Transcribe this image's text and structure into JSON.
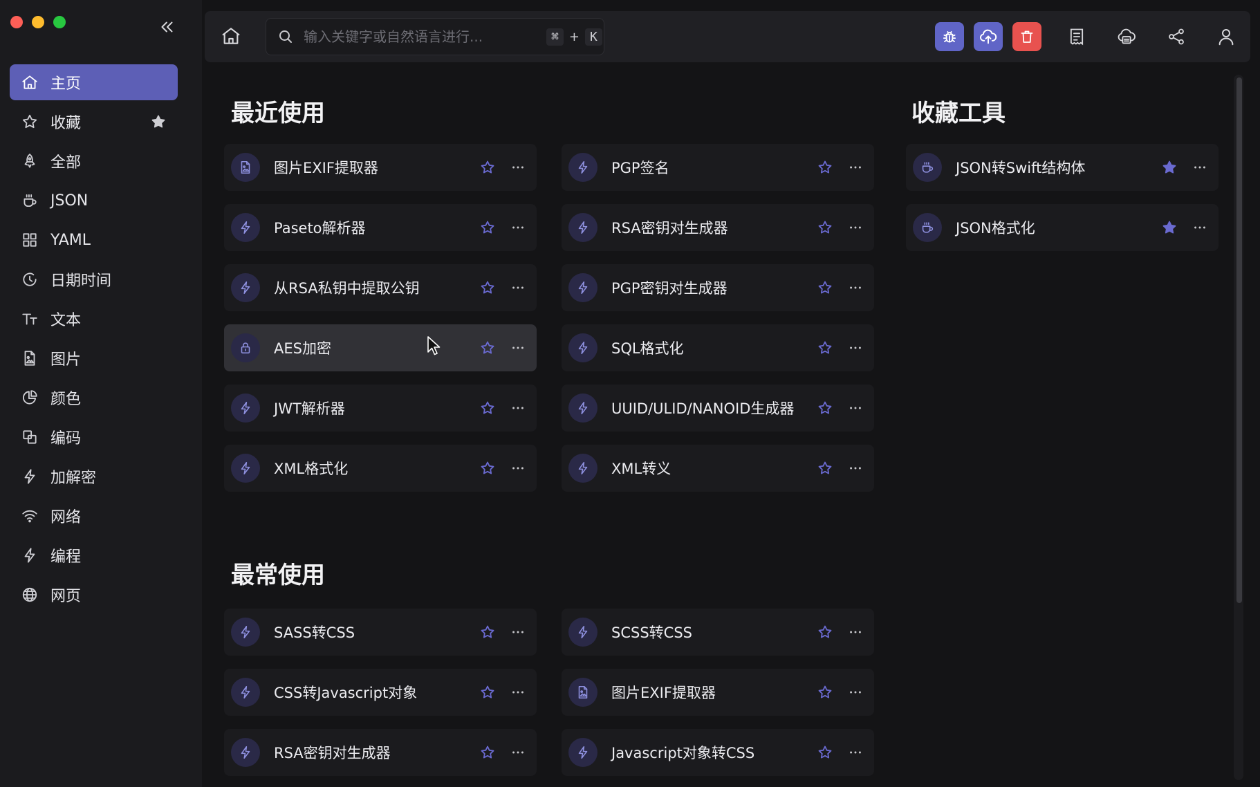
{
  "sidebar": {
    "items": [
      {
        "label": "主页",
        "icon": "home-icon"
      },
      {
        "label": "收藏",
        "icon": "star-icon"
      },
      {
        "label": "全部",
        "icon": "rocket-icon"
      },
      {
        "label": "JSON",
        "icon": "coffee-icon"
      },
      {
        "label": "YAML",
        "icon": "grid-icon"
      },
      {
        "label": "日期时间",
        "icon": "clock-icon"
      },
      {
        "label": "文本",
        "icon": "text-icon"
      },
      {
        "label": "图片",
        "icon": "file-image-icon"
      },
      {
        "label": "颜色",
        "icon": "pie-icon"
      },
      {
        "label": "编码",
        "icon": "copy-icon"
      },
      {
        "label": "加解密",
        "icon": "bolt-icon"
      },
      {
        "label": "网络",
        "icon": "wifi-icon"
      },
      {
        "label": "编程",
        "icon": "bolt-icon"
      },
      {
        "label": "网页",
        "icon": "globe-icon"
      }
    ]
  },
  "search": {
    "placeholder": "输入关键字或自然语言进行...",
    "shortcut_mod": "⌘",
    "shortcut_plus": "+",
    "shortcut_key": "K"
  },
  "recent": {
    "title": "最近使用",
    "items": [
      {
        "label": "图片EXIF提取器",
        "icon": "file-image-icon"
      },
      {
        "label": "PGP签名",
        "icon": "bolt-icon"
      },
      {
        "label": "Paseto解析器",
        "icon": "bolt-icon"
      },
      {
        "label": "RSA密钥对生成器",
        "icon": "bolt-icon"
      },
      {
        "label": "从RSA私钥中提取公钥",
        "icon": "bolt-icon"
      },
      {
        "label": "PGP密钥对生成器",
        "icon": "bolt-icon"
      },
      {
        "label": "AES加密",
        "icon": "lock-icon"
      },
      {
        "label": "SQL格式化",
        "icon": "bolt-icon"
      },
      {
        "label": "JWT解析器",
        "icon": "bolt-icon"
      },
      {
        "label": "UUID/ULID/NANOID生成器",
        "icon": "bolt-icon"
      },
      {
        "label": "XML格式化",
        "icon": "bolt-icon"
      },
      {
        "label": "XML转义",
        "icon": "bolt-icon"
      }
    ]
  },
  "frequent": {
    "title": "最常使用",
    "items": [
      {
        "label": "SASS转CSS",
        "icon": "bolt-icon"
      },
      {
        "label": "SCSS转CSS",
        "icon": "bolt-icon"
      },
      {
        "label": "CSS转Javascript对象",
        "icon": "bolt-icon"
      },
      {
        "label": "图片EXIF提取器",
        "icon": "file-image-icon"
      },
      {
        "label": "RSA密钥对生成器",
        "icon": "bolt-icon"
      },
      {
        "label": "Javascript对象转CSS",
        "icon": "bolt-icon"
      }
    ]
  },
  "favorites": {
    "title": "收藏工具",
    "items": [
      {
        "label": "JSON转Swift结构体",
        "icon": "coffee-icon"
      },
      {
        "label": "JSON格式化",
        "icon": "coffee-icon"
      }
    ]
  },
  "colors": {
    "accent": "#5d5fb6",
    "button_purple": "#6065c7",
    "button_red": "#e8524f",
    "star_outline": "#6a6ad0",
    "star_filled": "#6a6ad0"
  }
}
